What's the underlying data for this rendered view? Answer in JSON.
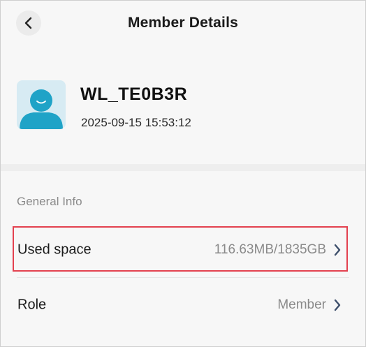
{
  "header": {
    "back_icon": "chevron-left-icon",
    "title": "Member Details"
  },
  "profile": {
    "avatar_icon": "user-avatar-icon",
    "avatar_color": "#1fa3c7",
    "username": "WL_TE0B3R",
    "created_at": "2025-09-15 15:53:12"
  },
  "general_info": {
    "title": "General Info",
    "rows": [
      {
        "label": "Used space",
        "value": "116.63MB/1835GB",
        "icon": "chevron-right-icon",
        "highlighted": true
      },
      {
        "label": "Role",
        "value": "Member",
        "icon": "chevron-right-icon",
        "highlighted": false
      }
    ]
  },
  "colors": {
    "highlight_border": "#e3414f",
    "chevron": "#3d4f6b"
  }
}
